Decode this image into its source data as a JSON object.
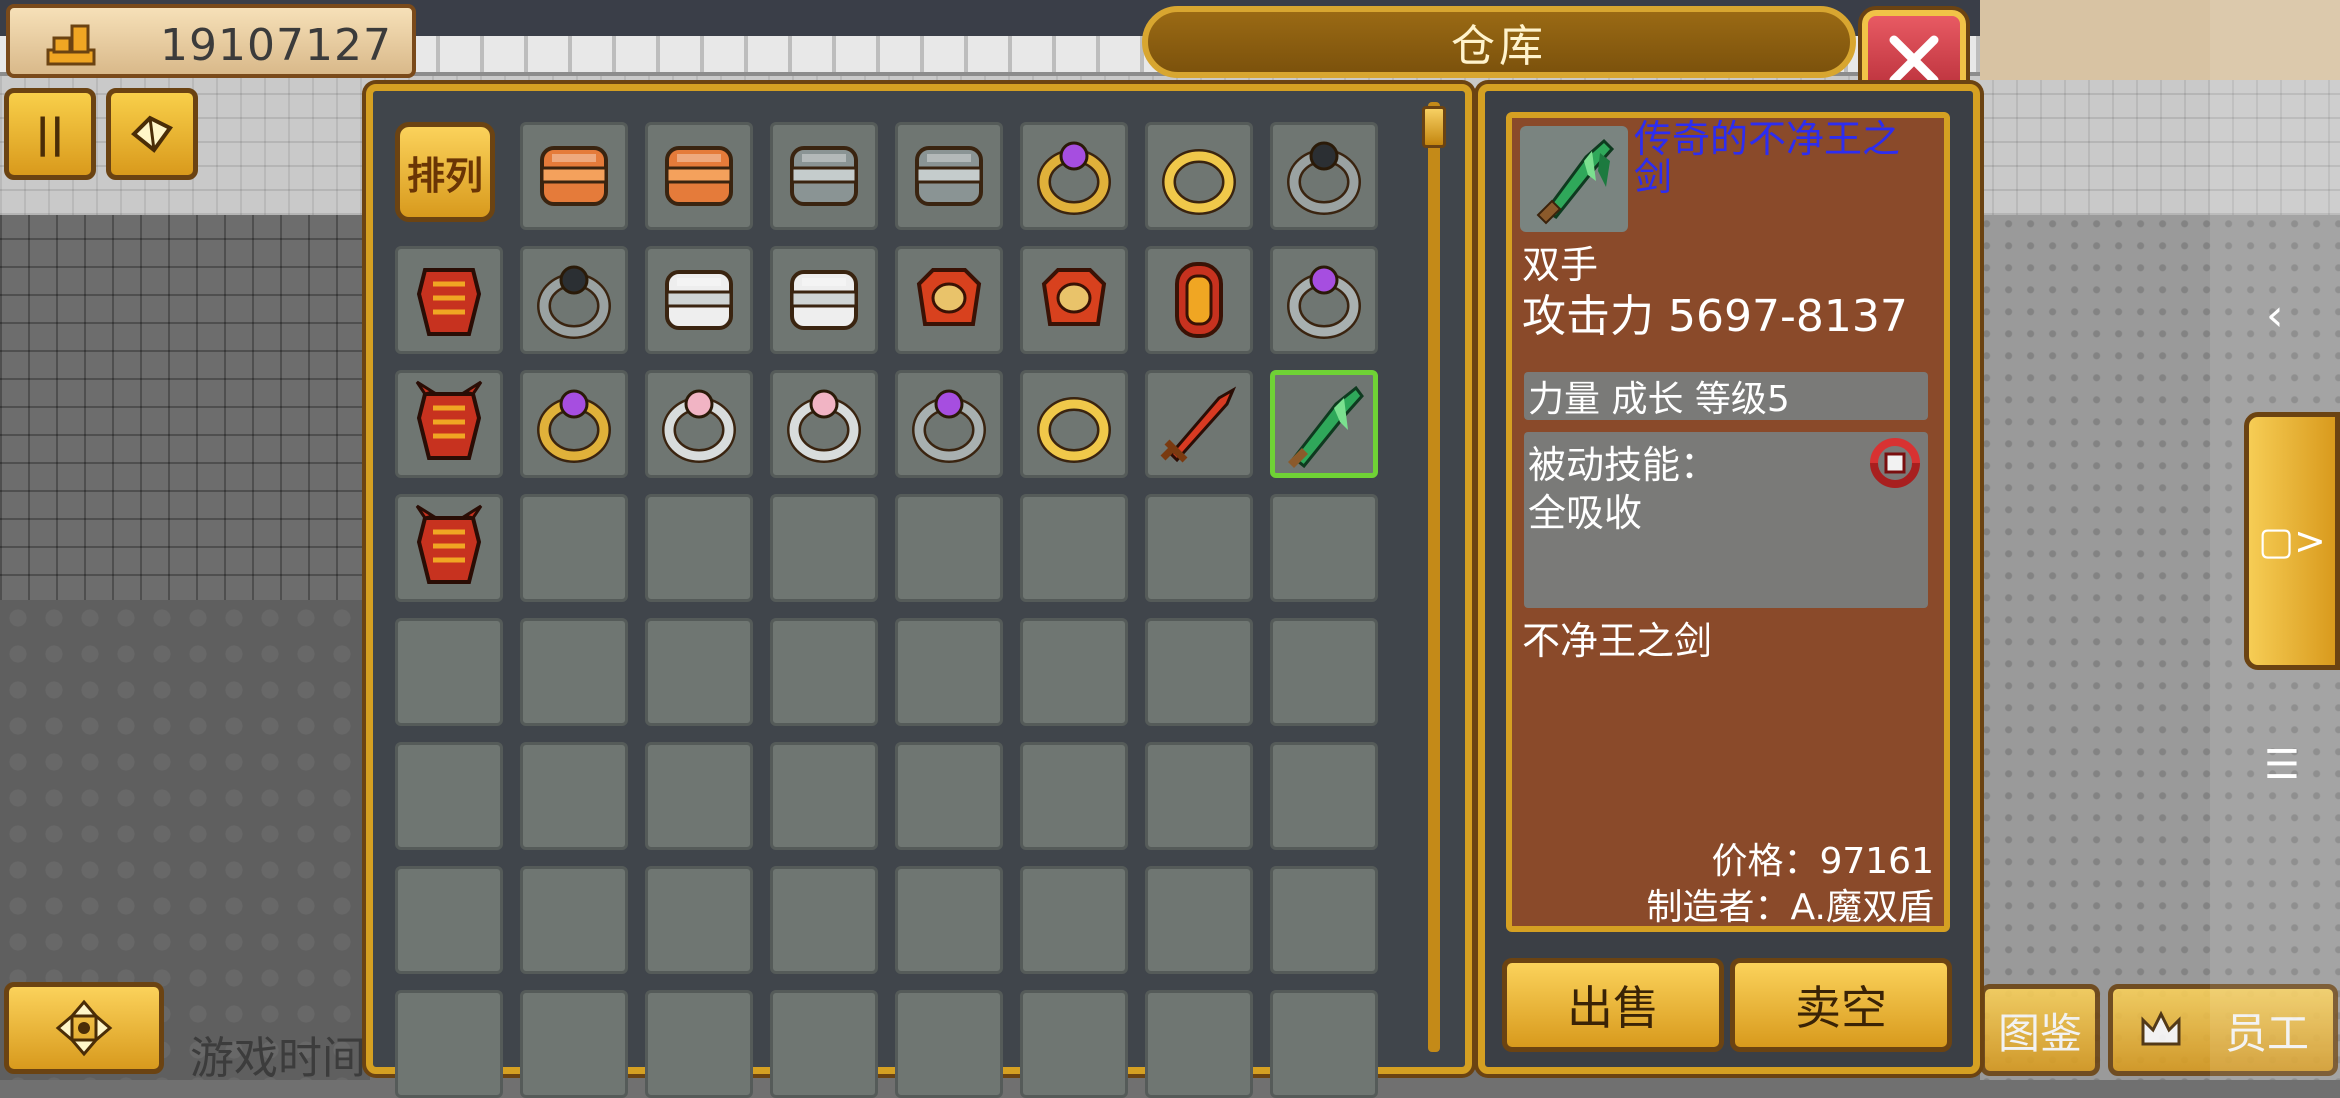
{
  "top": {
    "money": "19107127",
    "money_icon": "gold-bars-icon",
    "pause_label": "||",
    "pause_icon": "pause-icon",
    "map_icon": "map-icon"
  },
  "window": {
    "title": "仓库",
    "close_icon": "close-icon"
  },
  "inventory": {
    "sort_label": "排列",
    "items": [
      "chest-armor-orange",
      "chest-armor-orange",
      "chest-armor-gray",
      "chest-armor-gray",
      "ring-purple-gem-gold",
      "ring-gold",
      "ring-silver-black-gem",
      "armor-red-ribbed",
      "ring-silver-black-gem",
      "chest-armor-white",
      "chest-armor-white",
      "amulet-red",
      "amulet-red",
      "shield-red-oval",
      "ring-purple-gem-silver",
      "armor-red-horned",
      "ring-purple-gem-gold",
      "ring-pink-gem-silver",
      "ring-pink-gem-silver",
      "ring-purple-gem-silver",
      "ring-gold",
      "sword-red",
      "sword-green",
      "armor-red-horned"
    ],
    "selected_index": 22
  },
  "detail": {
    "icon": "green-sword-icon",
    "name": "传奇的不净王之剑",
    "hand": "双手",
    "attack": "攻击力 5697-8137",
    "growth": "力量 成长 等级5",
    "passive_label": "被动技能：",
    "passive_value": "全吸收",
    "passive_icon": "absorb-icon",
    "base_name": "不净王之剑",
    "price": "价格：97161",
    "maker": "制造者：A.魔双盾"
  },
  "actions": {
    "sell": "出售",
    "sell_all": "卖空"
  },
  "bottom": {
    "game_time": "游戏时间",
    "catalog": "图鉴",
    "staff": "员工",
    "dpad_icon": "dpad-icon",
    "staff_icon": "crown-icon"
  },
  "side": {
    "tab_label": "▢>",
    "back": "‹",
    "menu": "☰"
  },
  "colors": {
    "gold": "#d5a022",
    "frame_dark": "#6b4312",
    "panel": "#40454b",
    "slot": "#6f7672",
    "detail_bg": "#8a4a2a",
    "name_blue": "#2d2df0",
    "selected": "#6fd235"
  }
}
